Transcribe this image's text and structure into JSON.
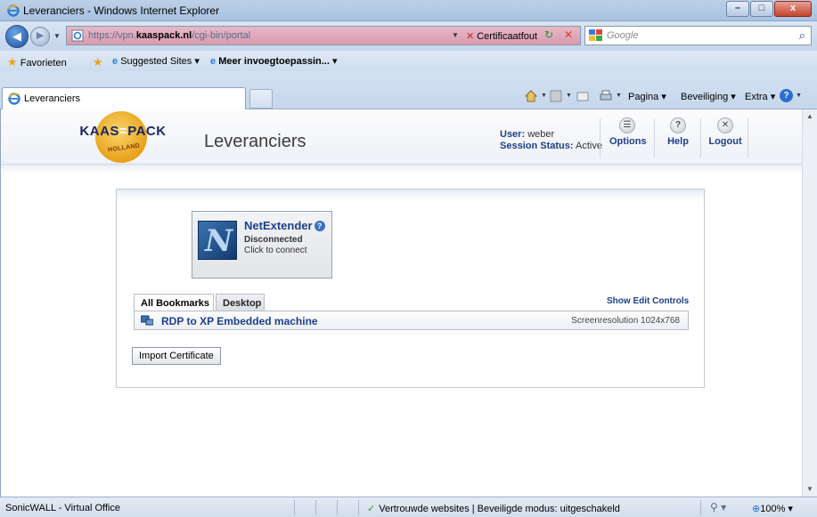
{
  "window": {
    "title": "Leveranciers - Windows Internet Explorer",
    "buttons": {
      "minimize": "–",
      "maximize": "□",
      "close": "x"
    }
  },
  "addressbar": {
    "url_prefix": "https://vpn.",
    "url_domain": "kaaspack.nl",
    "url_path": "/cgi-bin/portal",
    "cert_error": "Certificaatfout",
    "search_placeholder": "Google"
  },
  "favorites": {
    "favorites_label": "Favorieten",
    "suggested_sites": "Suggested Sites ▾",
    "more_addons": "Meer invoegtoepassin... ▾"
  },
  "tab": {
    "label": "Leveranciers"
  },
  "commandbar": {
    "page": "Pagina ▾",
    "safety": "Beveiliging ▾",
    "tools": "Extra ▾"
  },
  "portal": {
    "logo_left": "KAAS",
    "logo_eq": "=",
    "logo_right": "PACK",
    "logo_sub": "HOLLAND",
    "title": "Leveranciers",
    "user_label": "User:",
    "user_value": "weber",
    "session_label": "Session Status:",
    "session_value": "Active",
    "options": "Options",
    "help": "Help",
    "logout": "Logout"
  },
  "netextender": {
    "title": "NetExtender",
    "status": "Disconnected",
    "hint": "Click to connect"
  },
  "bookmarks": {
    "tabs": [
      "All Bookmarks",
      "Desktop"
    ],
    "show_edit": "Show Edit Controls",
    "items": [
      {
        "label": "RDP to XP Embedded machine",
        "detail": "Screenresolution 1024x768"
      }
    ],
    "import_button": "Import Certificate"
  },
  "statusbar": {
    "left": "SonicWALL - Virtual Office",
    "trust": "Vertrouwde websites | Beveiligde modus: uitgeschakeld",
    "zoom": "100%"
  }
}
